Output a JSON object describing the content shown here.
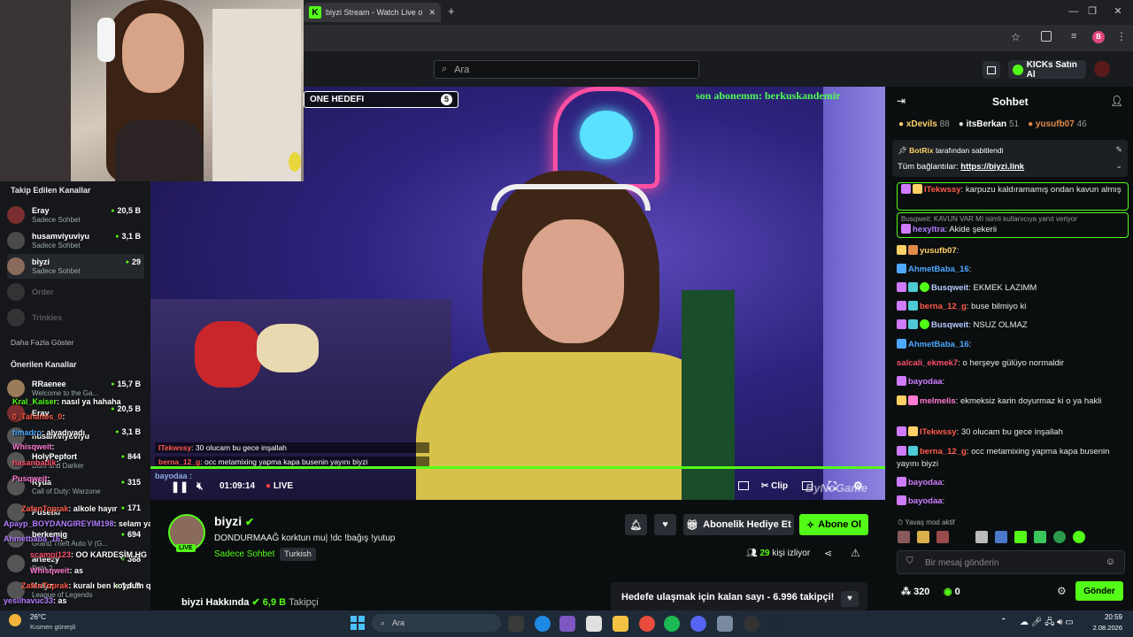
{
  "browser": {
    "tab_title": "biyzi Stream - Watch Live o",
    "tab_icon": "K",
    "new_tab": "+",
    "close_tab": "✕",
    "window_min": "—",
    "window_max": "❐",
    "window_close": "✕",
    "profile_initial": "B"
  },
  "header": {
    "search_placeholder": "Ara",
    "buy_kicks_label": "KICKs Satın Al"
  },
  "sidebar": {
    "followed_title": "Takip Edilen Kanallar",
    "followed": [
      {
        "name": "Eray",
        "sub": "Sadece Sohbet",
        "viewers": "20,5 B"
      },
      {
        "name": "husamviyuviyu",
        "sub": "Sadece Sohbet",
        "viewers": "3,1 B"
      },
      {
        "name": "biyzi",
        "sub": "Sadece Sohbet",
        "viewers": "29"
      },
      {
        "name": "Order",
        "sub": "",
        "viewers": ""
      },
      {
        "name": "Trinkies",
        "sub": "",
        "viewers": ""
      }
    ],
    "show_more": "Daha Fazla Göster",
    "suggested_title": "Önerilen Kanallar",
    "suggested": [
      {
        "name": "RRaenee",
        "sub": "Welcome to the Ga...",
        "viewers": "15,7 B"
      },
      {
        "name": "Eray",
        "sub": "",
        "viewers": "20,5 B"
      },
      {
        "name": "husamviyuviyu",
        "sub": "",
        "viewers": "3,1 B"
      },
      {
        "name": "HolyPepfort",
        "sub": "Dark and Darker",
        "viewers": "844"
      },
      {
        "name": "Ryda",
        "sub": "Call of Duty: Warzone",
        "viewers": "315"
      },
      {
        "name": "Pusetki",
        "sub": "",
        "viewers": "171"
      },
      {
        "name": "berkemig",
        "sub": "Grand Theft Auto V (G...",
        "viewers": "694"
      },
      {
        "name": "arteezy",
        "sub": "Dota 2",
        "viewers": "368"
      },
      {
        "name": "Kalyz",
        "sub": "League of Legends",
        "viewers": "1,4 B"
      }
    ]
  },
  "overlay_chat": [
    {
      "user": "Kral_Kaiser",
      "text": ": nasıl ya hahaha"
    },
    {
      "user": "0_Tahanos_0",
      "text": ":"
    },
    {
      "user": "timadro",
      "text": ": alyadıyadı"
    },
    {
      "user": "Whisqweit",
      "text": ":"
    },
    {
      "user": "hasanbadlk",
      "text": ":"
    },
    {
      "user": "Pusqweit",
      "text": ":"
    },
    {
      "user": "ZafenToprak",
      "text": ": alkole hayır"
    },
    {
      "user": "Apayp_BOYDANGIREYIM198",
      "text": ": selam ya"
    },
    {
      "user": "Ahmetbaba_16",
      "text": ":"
    },
    {
      "user": "scampi123",
      "text": ": OO KARDEŞİM HG"
    },
    {
      "user": "Whisqweit",
      "text": ": as"
    },
    {
      "user": "ZafenToprak",
      "text": ": kuralı ben koydum qlkzmxmms"
    },
    {
      "user": "yesilhavuc33",
      "text": ": as"
    }
  ],
  "video": {
    "goal_label": "ONE HEDEFI",
    "goal_count": "5",
    "last_sub": "son abonemm: berkuskandemir",
    "onscreen_chat": [
      {
        "user": "ITekwssy",
        "text": ": 30 olucam bu gece inşallah"
      },
      {
        "user": "berna_12_g",
        "text": ": occ metamixing yapma kapa busenin yayını biyzi"
      }
    ],
    "bayodaa": "bayodaa :",
    "time": "01:09:14",
    "live_label": "LIVE",
    "clip_label": "Clip",
    "watermark": "ByNoGame"
  },
  "stream_info": {
    "channel_name": "biyzi",
    "live_badge": "LIVE",
    "title": "DONDURMAAĞ korktun mu| !dc !bağış !yutup",
    "category": "Sadece Sohbet",
    "language": "Turkish",
    "viewers": "29",
    "viewers_suffix": "kişi izliyor",
    "gift_sub_label": "Abonelik Hediye Et",
    "subscribe_label": "Abone Ol",
    "about_label": "biyzi Hakkında",
    "followers_count": "6,9 B",
    "followers_label": "Takipçi",
    "goal_text": "Hedefe ulaşmak için kalan sayı - 6.996 takipçi!"
  },
  "chat": {
    "title": "Sohbet",
    "top_gifters": [
      {
        "name": "xDevils",
        "count": "88"
      },
      {
        "name": "itsBerkan",
        "count": "51"
      },
      {
        "name": "yusufb07",
        "count": "46"
      }
    ],
    "pinned_by": "BotRix",
    "pinned_suffix": "tarafından sabitlendi",
    "pinned_text": "Tüm bağlantılar: ",
    "pinned_link": "https://biyzi.link",
    "messages": [
      {
        "user": "ITekwssy",
        "color": "#ff5a4a",
        "text": ": karpuzu kaldıramamış ondan kavun almış",
        "highlight": true
      },
      {
        "reply": "Busqweit: KAVUN VAR MI isimli kullanıcıya yanıt veriyor",
        "user": "hexyltra",
        "color": "#b37cff",
        "text": ": Akide şekerii",
        "highlight": true
      },
      {
        "user": "yusufb07",
        "color": "#ffd166",
        "text": ":"
      },
      {
        "user": "AhmetBaba_16",
        "color": "#4ea8ff",
        "text": ":"
      },
      {
        "user": "Busqweit",
        "color": "#b6c8ff",
        "text": ": EKMEK LAZIMM"
      },
      {
        "user": "berna_12_g",
        "color": "#ff5a4a",
        "text": ": buse bilmiyo ki"
      },
      {
        "user": "Busqweit",
        "color": "#b6c8ff",
        "text": ": NSUZ OLMAZ"
      },
      {
        "user": "AhmetBaba_16",
        "color": "#4ea8ff",
        "text": ":"
      },
      {
        "user": "salcali_ekmek7",
        "color": "#ff4f6d",
        "text": ": o herşeye gülüyo normaldir"
      },
      {
        "user": "bayodaa",
        "color": "#d07cff",
        "text": ":"
      },
      {
        "user": "melmelis",
        "color": "#ff7ad1",
        "text": ": ekmeksiz karin doyurmaz ki o ya hakli"
      },
      {
        "user": "ITekwssy",
        "color": "#ff5a4a",
        "text": ": 30 olucam bu gece inşallah"
      },
      {
        "user": "berna_12_g",
        "color": "#ff5a4a",
        "text": ": occ metamixing yapma kapa busenin yayını biyzi"
      },
      {
        "user": "bayodaa",
        "color": "#d07cff",
        "text": ":"
      },
      {
        "user": "bayodaa",
        "color": "#d07cff",
        "text": ":"
      }
    ],
    "slow_mode": "Yavaş mod aktif",
    "input_placeholder": "Bir mesaj gönderin",
    "points": "320",
    "kicks": "0",
    "send_label": "Gönder"
  },
  "taskbar": {
    "weather_temp": "26°C",
    "weather_desc": "Kısmen güneşli",
    "search_label": "Ara",
    "time": "20:59",
    "date": "2.08.2026"
  },
  "colors": {
    "kick_green": "#53fc18",
    "bg": "#0b0e0f"
  }
}
